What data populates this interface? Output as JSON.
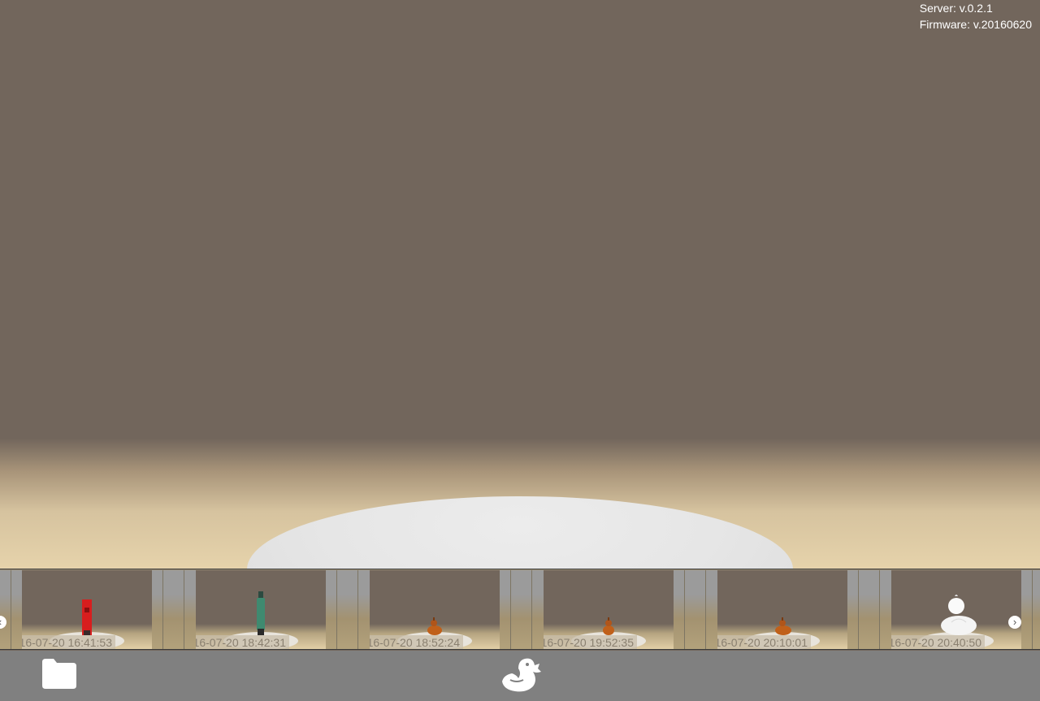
{
  "viewer": {
    "server_version": "Server: v.0.2.1",
    "firmware_version": "Firmware: v.20160620"
  },
  "scans": [
    {
      "timestamp": "2016-07-20 16:41:53",
      "object": "red-box"
    },
    {
      "timestamp": "2016-07-20 18:42:31",
      "object": "green-bottle"
    },
    {
      "timestamp": "2016-07-20 18:52:24",
      "object": "orange-duck"
    },
    {
      "timestamp": "2016-07-20 19:52:35",
      "object": "orange-duck"
    },
    {
      "timestamp": "2016-07-20 20:10:01",
      "object": "orange-duck"
    },
    {
      "timestamp": "2016-07-20 20:40:50",
      "object": "white-duck"
    }
  ],
  "strip_nav": {
    "prev_icon": "chevron-left-icon",
    "next_icon": "chevron-right-icon"
  },
  "footer": {
    "open_icon": "folder-icon",
    "scan_icon": "duck-icon"
  },
  "colors": {
    "background": "#72665c",
    "floor": "#e6d3ab",
    "platter": "#e6e6e6",
    "footer": "#808080"
  }
}
